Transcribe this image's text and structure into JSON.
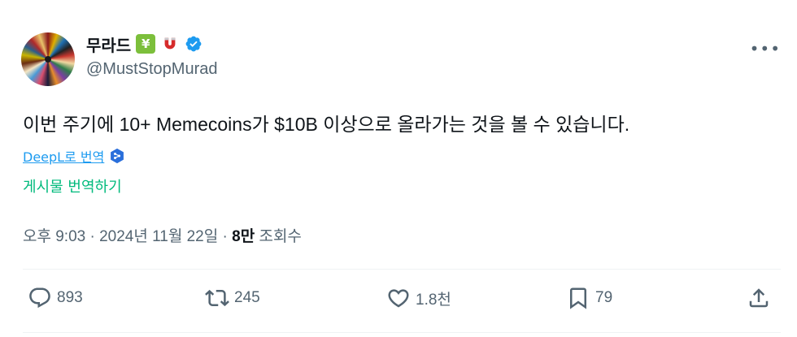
{
  "author": {
    "display_name": "무라드",
    "emoji_1": "💹",
    "emoji_2": "🧲",
    "handle": "@MustStopMurad",
    "verified": true
  },
  "tweet": {
    "text": "이번 주기에 10+ Memecoins가 $10B 이상으로 올라가는 것을 볼 수 있습니다."
  },
  "translation": {
    "deepl_label": "DeepL로 번역",
    "translate_post_label": "게시물 번역하기"
  },
  "meta": {
    "time": "오후 9:03",
    "separator": "·",
    "date": "2024년 11월 22일",
    "views_count": "8만",
    "views_label": "조회수"
  },
  "actions": {
    "replies": "893",
    "reposts": "245",
    "likes": "1.8천",
    "bookmarks": "79"
  },
  "colors": {
    "accent": "#1d9bf0",
    "translate_green": "#00ba7c",
    "muted": "#536471",
    "text": "#0f1419"
  }
}
